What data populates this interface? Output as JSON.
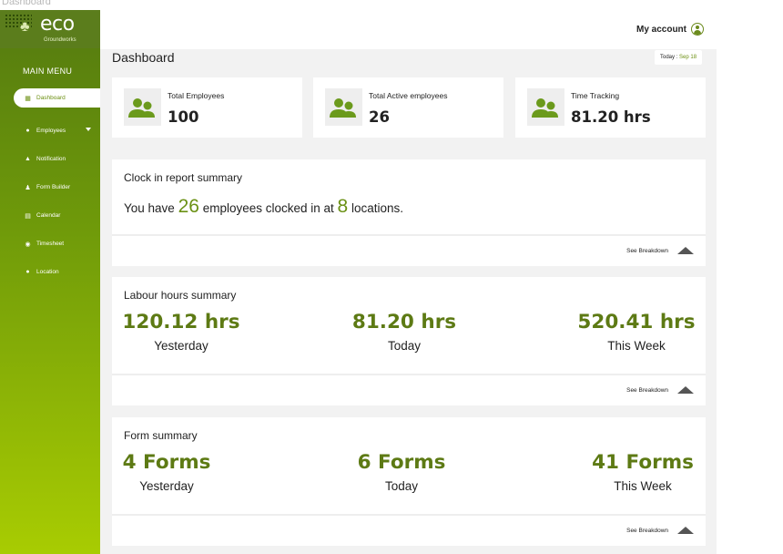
{
  "page_label": "Dashboard",
  "brand": {
    "logo_text": "eco",
    "logo_sub": "Groundworks",
    "logo_icon": "tree-icon"
  },
  "sidebar": {
    "menu_title": "MAIN MENU",
    "items": [
      {
        "label": "Dashboard",
        "icon": "grid-icon",
        "active": true
      },
      {
        "label": "Employees",
        "icon": "user-icon",
        "has_submenu": true
      },
      {
        "label": "Notification",
        "icon": "bell-icon"
      },
      {
        "label": "Form Builder",
        "icon": "person-icon"
      },
      {
        "label": "Calendar",
        "icon": "calendar-icon"
      },
      {
        "label": "Timesheet",
        "icon": "clock-icon"
      },
      {
        "label": "Location",
        "icon": "pin-icon"
      }
    ],
    "gradient": [
      "#547a10",
      "#a8cc02"
    ]
  },
  "header": {
    "account_label": "My account",
    "account_icon": "account-icon"
  },
  "main": {
    "title": "Dashboard",
    "today_prefix": "Today :",
    "today_value": "Sep 18"
  },
  "stats": [
    {
      "label": "Total Employees",
      "value": "100",
      "icon": "people-icon"
    },
    {
      "label": "Total Active employees",
      "value": "26",
      "icon": "people-icon"
    },
    {
      "label": "Time Tracking",
      "value": "81.20 hrs",
      "icon": "people-icon"
    }
  ],
  "clock_report": {
    "title": "Clock in report summary",
    "text_1": "You have",
    "employees": "26",
    "text_2": "employees clocked in at",
    "locations": "8",
    "text_3": "locations.",
    "breakdown": "See Breakdown"
  },
  "labour": {
    "title": "Labour hours summary",
    "items": [
      {
        "value": "120.12 hrs",
        "label": "Yesterday"
      },
      {
        "value": "81.20 hrs",
        "label": "Today"
      },
      {
        "value": "520.41 hrs",
        "label": "This Week"
      }
    ],
    "breakdown": "See Breakdown"
  },
  "forms": {
    "title": "Form summary",
    "items": [
      {
        "value": "4 Forms",
        "label": "Yesterday"
      },
      {
        "value": "6 Forms",
        "label": "Today"
      },
      {
        "value": "41 Forms",
        "label": "This Week"
      }
    ],
    "breakdown": "See Breakdown"
  },
  "colors": {
    "accent": "#6b9115",
    "value_green": "#5d7a14",
    "background": "#f2f2f2"
  }
}
